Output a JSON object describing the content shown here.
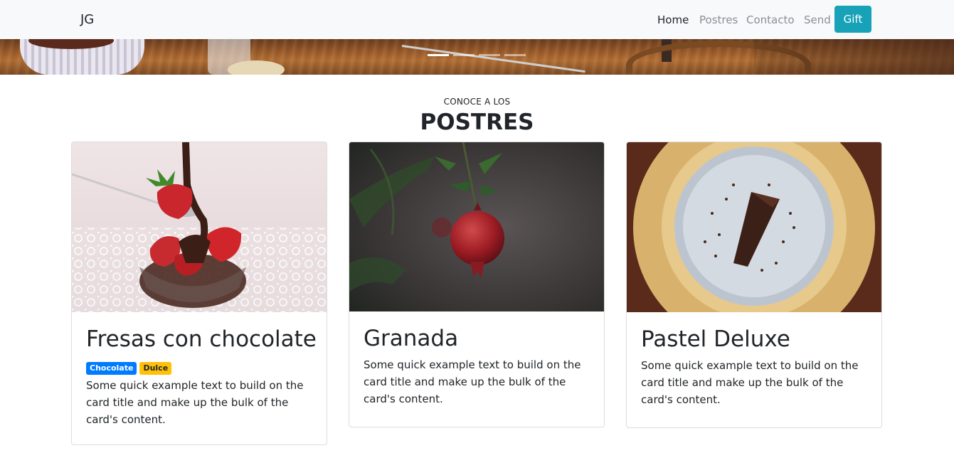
{
  "navbar": {
    "brand": "JG",
    "links": [
      {
        "label": "Home",
        "active": true
      },
      {
        "label": "Postres",
        "active": false
      },
      {
        "label": "Contacto",
        "active": false
      },
      {
        "label": "Send",
        "active": false
      }
    ],
    "gift_button": "Gift"
  },
  "carousel": {
    "slide_count": 4,
    "active_index": 0
  },
  "section": {
    "subtitle": "CONOCE A LOS",
    "title": "POSTRES"
  },
  "cards": [
    {
      "title": "Fresas con chocolate",
      "badges": [
        "Chocolate",
        "Dulce"
      ],
      "text": "Some quick example text to build on the card title and make up the bulk of the card's content."
    },
    {
      "title": "Granada",
      "text": "Some quick example text to build on the card title and make up the bulk of the card's content."
    },
    {
      "title": "Pastel Deluxe",
      "text": "Some quick example text to build on the card title and make up the bulk of the card's content."
    }
  ],
  "colors": {
    "navbar_bg": "#f8f9fa",
    "gift_button": "#17a2b8",
    "badge_primary": "#007bff",
    "badge_warning": "#ffc107"
  }
}
